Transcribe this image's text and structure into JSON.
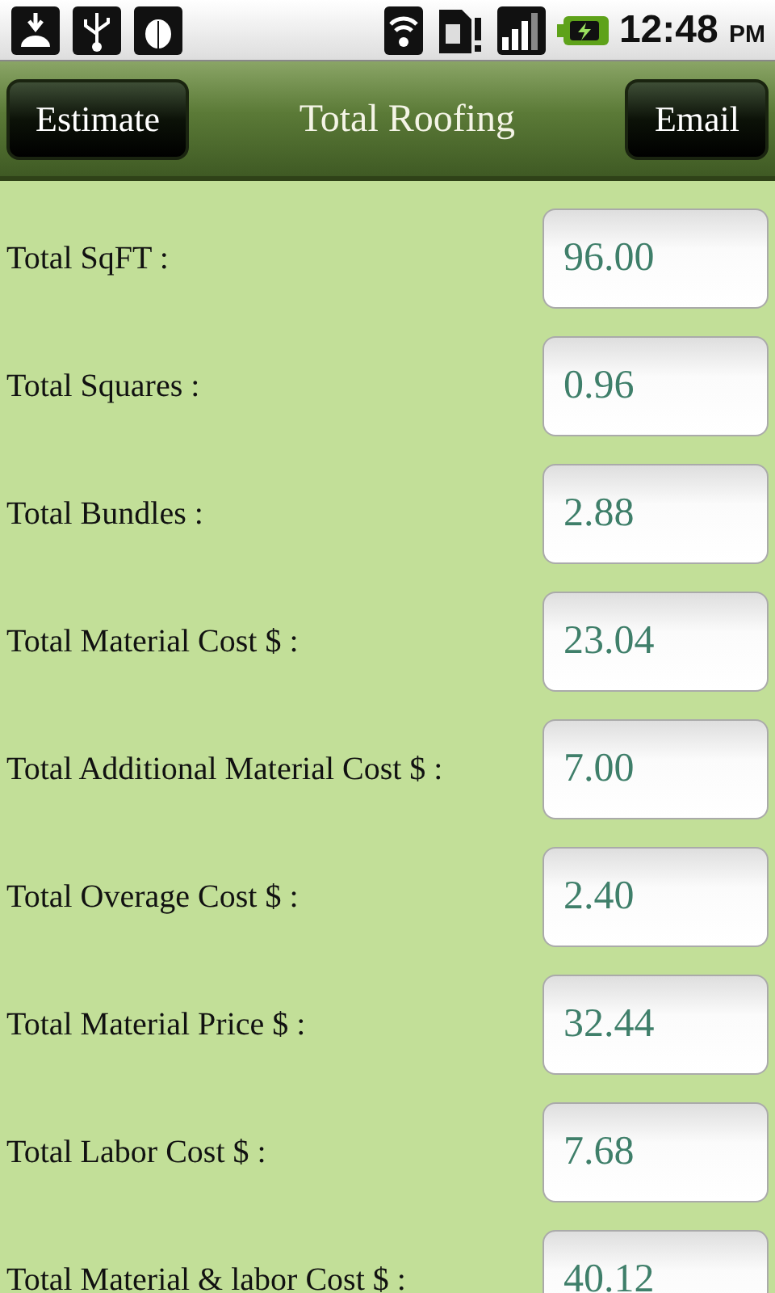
{
  "status_bar": {
    "time": "12:48",
    "ampm": "PM"
  },
  "header": {
    "left_button": "Estimate",
    "title": "Total Roofing",
    "right_button": "Email"
  },
  "rows": [
    {
      "label": "Total SqFT :",
      "value": "96.00"
    },
    {
      "label": "Total Squares :",
      "value": "0.96"
    },
    {
      "label": "Total Bundles :",
      "value": "2.88"
    },
    {
      "label": "Total Material Cost $ :",
      "value": "23.04"
    },
    {
      "label": "Total Additional Material Cost $ :",
      "value": "7.00"
    },
    {
      "label": "Total Overage Cost $ :",
      "value": "2.40"
    },
    {
      "label": "Total Material Price $ :",
      "value": "32.44"
    },
    {
      "label": "Total Labor Cost $ :",
      "value": "7.68"
    },
    {
      "label": "Total Material & labor Cost $ :",
      "value": "40.12"
    }
  ]
}
